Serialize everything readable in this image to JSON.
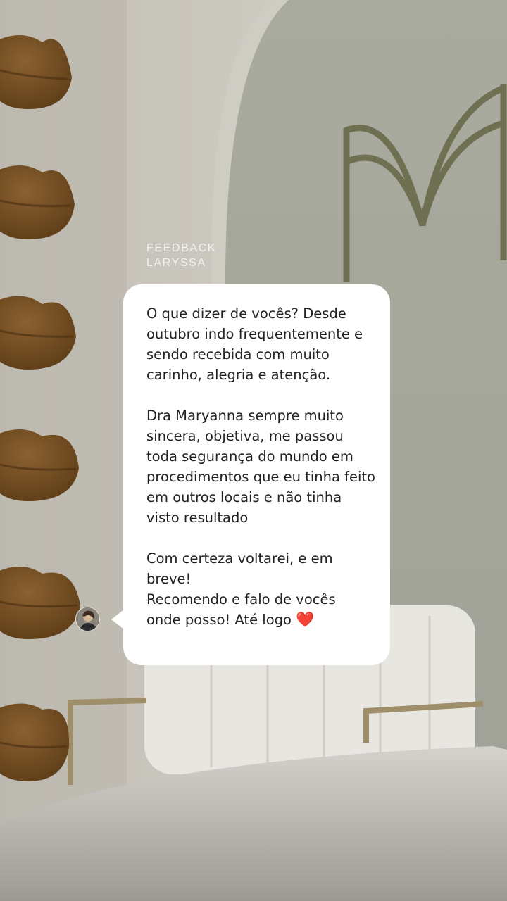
{
  "header": {
    "line1": "FEEDBACK",
    "line2": "LARYSSA"
  },
  "message": {
    "paragraph1": "O que dizer de vocês? Desde\noutubro indo frequentemente e\nsendo recebida com muito\ncarinho, alegria e atenção.",
    "paragraph2": "Dra Maryanna sempre muito\nsincera, objetiva, me passou\ntoda segurança do mundo em\nprocedimentos que eu tinha feito\nem outros locais e não tinha\nvisto resultado",
    "paragraph3_a": "Com certeza voltarei, e em\nbreve!\nRecomendo e falo de vocês\nonde posso! Até logo ",
    "heart": "❤️"
  },
  "colors": {
    "bubble": "#ffffff",
    "heart": "#d81e2a",
    "lips": "#7a5326",
    "wall": "#a9aa9f"
  },
  "icons": {
    "avatar": "profile-photo",
    "logo": "m-monogram-icon"
  }
}
